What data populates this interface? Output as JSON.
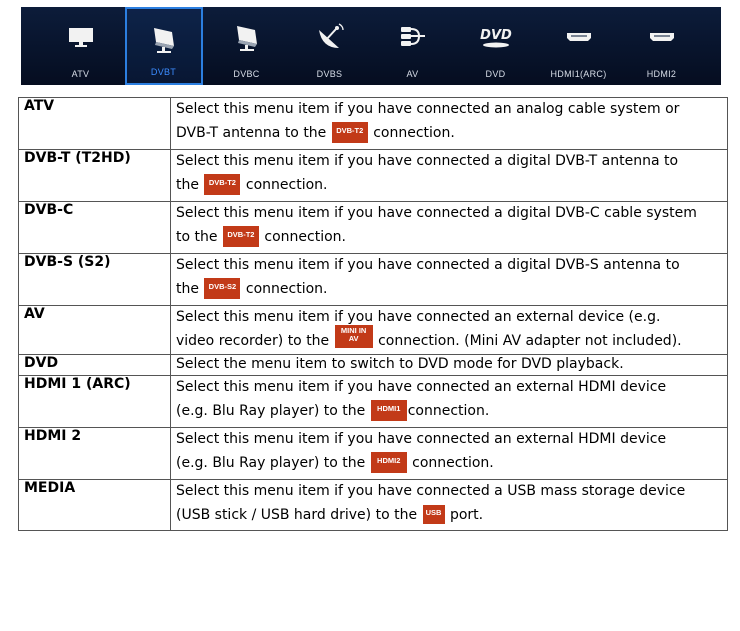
{
  "sources": [
    {
      "label": "ATV",
      "icon": "tv-icon",
      "active": false
    },
    {
      "label": "DVBT",
      "icon": "antenna-tv-icon",
      "active": true
    },
    {
      "label": "DVBC",
      "icon": "cable-tv-icon",
      "active": false
    },
    {
      "label": "DVBS",
      "icon": "satellite-dish-icon",
      "active": false
    },
    {
      "label": "AV",
      "icon": "av-cable-icon",
      "active": false
    },
    {
      "label": "DVD",
      "icon": "dvd-logo-icon",
      "active": false
    },
    {
      "label": "HDMI1(ARC)",
      "icon": "hdmi-connector-icon",
      "active": false
    },
    {
      "label": "HDMI2",
      "icon": "hdmi-connector-icon",
      "active": false
    }
  ],
  "colors": {
    "bar": "#0c1c3a",
    "active": "#2c7fe0",
    "badge": "#c23a18"
  },
  "rows": [
    {
      "key": "ATV",
      "l1": "Select this menu item if you have connected an analog cable system or",
      "pre": "DVB-T antenna to the ",
      "badge": "DVB-T2",
      "post": " connection."
    },
    {
      "key": "DVB-T (T2HD)",
      "l1": "Select this menu item if you have connected a digital DVB-T antenna to",
      "pre": "the ",
      "badge": "DVB-T2",
      "post": " connection."
    },
    {
      "key": "DVB-C",
      "l1": "Select this menu item if you have connected a digital DVB-C cable system",
      "pre": "to the ",
      "badge": "DVB-T2",
      "post": " connection."
    },
    {
      "key": "DVB-S (S2)",
      "l1": "Select this menu item if you have connected a digital DVB-S antenna to",
      "pre": "the ",
      "badge": "DVB-S2",
      "post": " connection."
    },
    {
      "key": "AV",
      "l1": "Select this menu item if you have connected an external device (e.g.",
      "pre": "video recorder) to the ",
      "badge_top": "MINI IN",
      "badge": "AV",
      "post": " connection. (Mini AV adapter not included)."
    },
    {
      "key": "DVD",
      "l1": "Select the menu item to switch to DVD mode for DVD playback."
    },
    {
      "key": "HDMI 1 (ARC)",
      "l1": "Select this menu item if you have connected an external HDMI device",
      "pre": "(e.g. Blu Ray player) to the ",
      "badge": "HDMI1",
      "post": "connection."
    },
    {
      "key": "HDMI 2",
      "l1": "Select this menu item if you have connected an external HDMI device",
      "pre": "(e.g. Blu Ray player) to the ",
      "badge": "HDMI2",
      "post": " connection."
    },
    {
      "key": "MEDIA",
      "l1": "Select this menu item if you have connected a USB mass storage device",
      "pre": "(USB stick / USB hard drive) to the ",
      "badge": "USB",
      "post": " port."
    }
  ]
}
